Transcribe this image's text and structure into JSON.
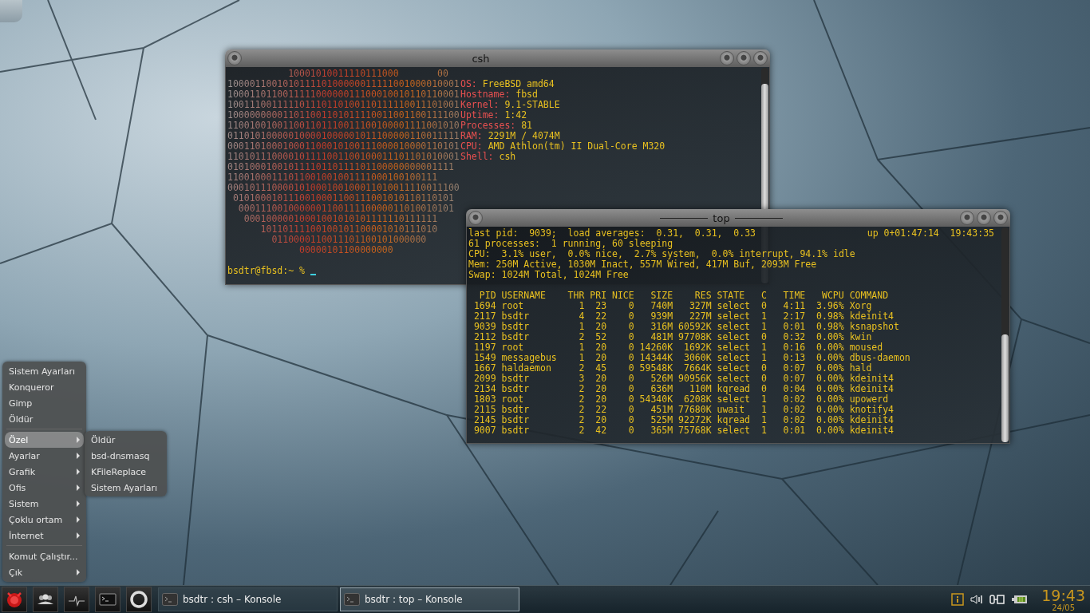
{
  "csh_window": {
    "title": "csh",
    "art": [
      "           10001010011110111000       00",
      "100001100101011110100000011111001000010001",
      "100011011001111100000011100010010110110001",
      "100111001111101110110100110111110011101001",
      "100000000011011001101011110011001100111100",
      "110010010011001101110011100100001111001010",
      "011010100000100001000001011100000110011111",
      "000110100010001100010100111000010000110101",
      "110101110000101111001100100011101101010001",
      "01010001001011110110111101100000000001111",
      "11001000111011001001001111000100100111",
      "000101110000101000100100011010011110011100",
      " 0101000101110010001100111001010110110101",
      "  000111001000000110011110000011010010101",
      "   00010000010001001010101111110111111",
      "      10110111100100101100001010111010",
      "        0110000110011101100101000000",
      "             00000101100000000"
    ],
    "info": [
      {
        "label": "OS:",
        "value": "FreeBSD amd64"
      },
      {
        "label": "Hostname:",
        "value": "fbsd"
      },
      {
        "label": "Kernel:",
        "value": "9.1-STABLE"
      },
      {
        "label": "Uptime:",
        "value": "1:42"
      },
      {
        "label": "Processes:",
        "value": "81"
      },
      {
        "label": "RAM:",
        "value": "2291M / 4074M"
      },
      {
        "label": "CPU:",
        "value": "AMD Athlon(tm) II Dual-Core M320"
      },
      {
        "label": "Shell:",
        "value": "csh"
      }
    ],
    "prompt": "bsdtr@fbsd:~ %"
  },
  "top_window": {
    "title": "top",
    "summary": [
      "last pid:  9039;  load averages:  0.31,  0.31,  0.33",
      "61 processes:  1 running, 60 sleeping",
      "CPU:  3.1% user,  0.0% nice,  2.7% system,  0.0% interrupt, 94.1% idle",
      "Mem: 250M Active, 1030M Inact, 557M Wired, 417M Buf, 2093M Free",
      "Swap: 1024M Total, 1024M Free"
    ],
    "uptime": "up 0+01:47:14  19:43:35",
    "columns": [
      "PID",
      "USERNAME",
      "THR",
      "PRI",
      "NICE",
      "SIZE",
      "RES",
      "STATE",
      "C",
      "TIME",
      "WCPU",
      "COMMAND"
    ],
    "rows": [
      [
        "1694",
        "root",
        "1",
        "23",
        "0",
        "740M",
        "327M",
        "select",
        "0",
        "4:11",
        "3.96%",
        "Xorg"
      ],
      [
        "2117",
        "bsdtr",
        "4",
        "22",
        "0",
        "939M",
        "227M",
        "select",
        "1",
        "2:17",
        "0.98%",
        "kdeinit4"
      ],
      [
        "9039",
        "bsdtr",
        "1",
        "20",
        "0",
        "316M",
        "60592K",
        "select",
        "1",
        "0:01",
        "0.98%",
        "ksnapshot"
      ],
      [
        "2112",
        "bsdtr",
        "2",
        "52",
        "0",
        "481M",
        "97708K",
        "select",
        "0",
        "0:32",
        "0.00%",
        "kwin"
      ],
      [
        "1197",
        "root",
        "1",
        "20",
        "0",
        "14260K",
        "1692K",
        "select",
        "1",
        "0:16",
        "0.00%",
        "moused"
      ],
      [
        "1549",
        "messagebus",
        "1",
        "20",
        "0",
        "14344K",
        "3060K",
        "select",
        "1",
        "0:13",
        "0.00%",
        "dbus-daemon"
      ],
      [
        "1667",
        "haldaemon",
        "2",
        "45",
        "0",
        "59548K",
        "7664K",
        "select",
        "0",
        "0:07",
        "0.00%",
        "hald"
      ],
      [
        "2099",
        "bsdtr",
        "3",
        "20",
        "0",
        "526M",
        "90956K",
        "select",
        "0",
        "0:07",
        "0.00%",
        "kdeinit4"
      ],
      [
        "2134",
        "bsdtr",
        "2",
        "20",
        "0",
        "636M",
        "110M",
        "kqread",
        "0",
        "0:04",
        "0.00%",
        "kdeinit4"
      ],
      [
        "1803",
        "root",
        "2",
        "20",
        "0",
        "54340K",
        "6208K",
        "select",
        "1",
        "0:02",
        "0.00%",
        "upowerd"
      ],
      [
        "2115",
        "bsdtr",
        "2",
        "22",
        "0",
        "451M",
        "77680K",
        "uwait",
        "1",
        "0:02",
        "0.00%",
        "knotify4"
      ],
      [
        "2145",
        "bsdtr",
        "2",
        "20",
        "0",
        "525M",
        "92272K",
        "kqread",
        "1",
        "0:02",
        "0.00%",
        "kdeinit4"
      ],
      [
        "9007",
        "bsdtr",
        "2",
        "42",
        "0",
        "365M",
        "75768K",
        "select",
        "1",
        "0:01",
        "0.00%",
        "kdeinit4"
      ]
    ]
  },
  "menu": {
    "items": [
      {
        "kind": "item",
        "label": "Sistem Ayarları",
        "submenu": false,
        "selected": false
      },
      {
        "kind": "item",
        "label": "Konqueror",
        "submenu": false,
        "selected": false
      },
      {
        "kind": "item",
        "label": "Gimp",
        "submenu": false,
        "selected": false
      },
      {
        "kind": "item",
        "label": "Öldür",
        "submenu": false,
        "selected": false
      },
      {
        "kind": "separator"
      },
      {
        "kind": "item",
        "label": "Özel",
        "submenu": true,
        "selected": true
      },
      {
        "kind": "item",
        "label": "Ayarlar",
        "submenu": true,
        "selected": false
      },
      {
        "kind": "item",
        "label": "Grafik",
        "submenu": true,
        "selected": false
      },
      {
        "kind": "item",
        "label": "Ofis",
        "submenu": true,
        "selected": false
      },
      {
        "kind": "item",
        "label": "Sistem",
        "submenu": true,
        "selected": false
      },
      {
        "kind": "item",
        "label": "Çoklu ortam",
        "submenu": true,
        "selected": false
      },
      {
        "kind": "item",
        "label": "İnternet",
        "submenu": true,
        "selected": false
      },
      {
        "kind": "separator"
      },
      {
        "kind": "item",
        "label": "Komut Çalıştır...",
        "submenu": false,
        "selected": false
      },
      {
        "kind": "item",
        "label": "Çık",
        "submenu": true,
        "selected": false
      }
    ]
  },
  "submenu": {
    "items": [
      "Öldür",
      "bsd-dnsmasq",
      "KFileReplace",
      "Sistem Ayarları"
    ]
  },
  "taskbar": {
    "tasks": [
      {
        "label": "bsdtr : csh – Konsole",
        "selected": false
      },
      {
        "label": "bsdtr : top – Konsole",
        "selected": true
      }
    ],
    "clock": {
      "time": "19:43",
      "date": "24/05"
    }
  }
}
